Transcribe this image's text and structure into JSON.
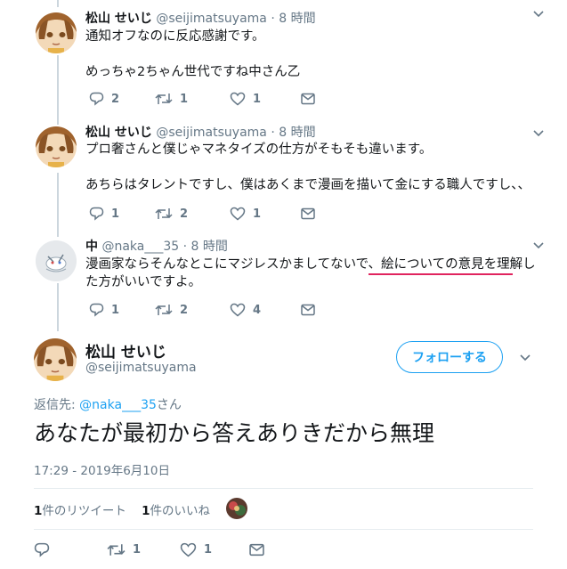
{
  "tweets": [
    {
      "name": "松山 せいじ",
      "handle": "@seijimatsuyama",
      "dot": "·",
      "time": "8 時間",
      "lines": [
        "通知オフなのに反応感謝です。",
        "",
        "めっちゃ2ちゃん世代ですね中さん乙"
      ],
      "reply_count": "2",
      "retweet_count": "1",
      "like_count": "1"
    },
    {
      "name": "松山 せいじ",
      "handle": "@seijimatsuyama",
      "dot": "·",
      "time": "8 時間",
      "lines": [
        "プロ奢さんと僕じゃマネタイズの仕方がそもそも違います。",
        "",
        "あちらはタレントですし、僕はあくまで漫画を描いて金にする職人ですし、、"
      ],
      "reply_count": "1",
      "retweet_count": "2",
      "like_count": "1"
    },
    {
      "name": "中",
      "handle": "@naka___35",
      "dot": "·",
      "time": "8 時間",
      "lines": [
        "漫画家ならそんなとこにマジレスかましてないで、絵についての意見を理解し",
        "た方がいいですよ。"
      ],
      "reply_count": "1",
      "retweet_count": "2",
      "like_count": "4"
    }
  ],
  "main_tweet": {
    "name": "松山 せいじ",
    "handle": "@seijimatsuyama",
    "follow_label": "フォローする",
    "reply_to_prefix": "返信先: ",
    "reply_to_mention": "@naka___35",
    "reply_to_suffix": "さん",
    "text": "あなたが最初から答えありきだから無理",
    "timestamp": "17:29 - 2019年6月10日",
    "retweet_num": "1",
    "retweet_label": "件のリツイート",
    "like_num": "1",
    "like_label": "件のいいね",
    "retweet_count": "1",
    "like_count": "1"
  },
  "colors": {
    "accent": "#1da1f2",
    "muted": "#657786",
    "annotation_underline": "#e0245e"
  },
  "icons": [
    "reply-icon",
    "retweet-icon",
    "like-icon",
    "direct-message-icon",
    "chevron-down-icon"
  ]
}
